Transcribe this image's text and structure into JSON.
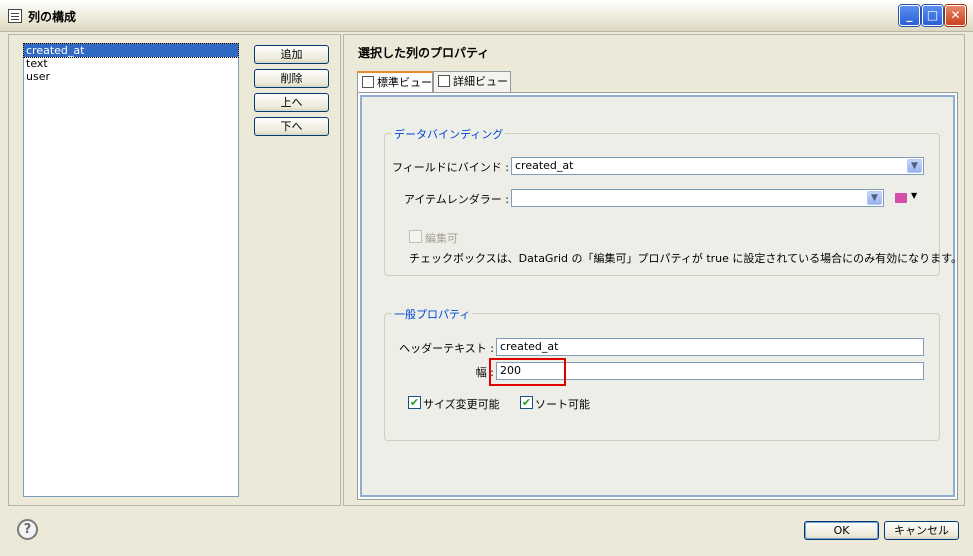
{
  "window": {
    "title": "列の構成"
  },
  "columns_list": {
    "items": [
      "created_at",
      "text",
      "user"
    ],
    "selected_index": 0
  },
  "list_buttons": {
    "add": "追加",
    "delete": "削除",
    "up": "上へ",
    "down": "下へ"
  },
  "properties": {
    "section_title": "選択した列のプロパティ",
    "tabs": [
      {
        "label": "標準ビュー",
        "active": true
      },
      {
        "label": "詳細ビュー",
        "active": false
      }
    ],
    "data_binding": {
      "group_label": "データバインディング",
      "bind_field_label": "フィールドにバインド :",
      "bind_field_value": "created_at",
      "item_renderer_label": "アイテムレンダラー :",
      "item_renderer_value": "",
      "editable_label": "編集可",
      "editable_checked": false,
      "note": "チェックボックスは、DataGrid の「編集可」プロパティが true に設定されている場合にのみ有効になります。"
    },
    "general": {
      "group_label": "一般プロパティ",
      "header_text_label": "ヘッダーテキスト :",
      "header_text_value": "created_at",
      "width_label": "幅 :",
      "width_value": "200",
      "resizable_label": "サイズ変更可能",
      "resizable_checked": true,
      "sortable_label": "ソート可能",
      "sortable_checked": true
    }
  },
  "footer": {
    "ok": "OK",
    "cancel": "キャンセル",
    "help_glyph": "?"
  },
  "colors": {
    "accent": "#316ac5",
    "group_label": "#0046d5",
    "highlight": "#e00000"
  }
}
